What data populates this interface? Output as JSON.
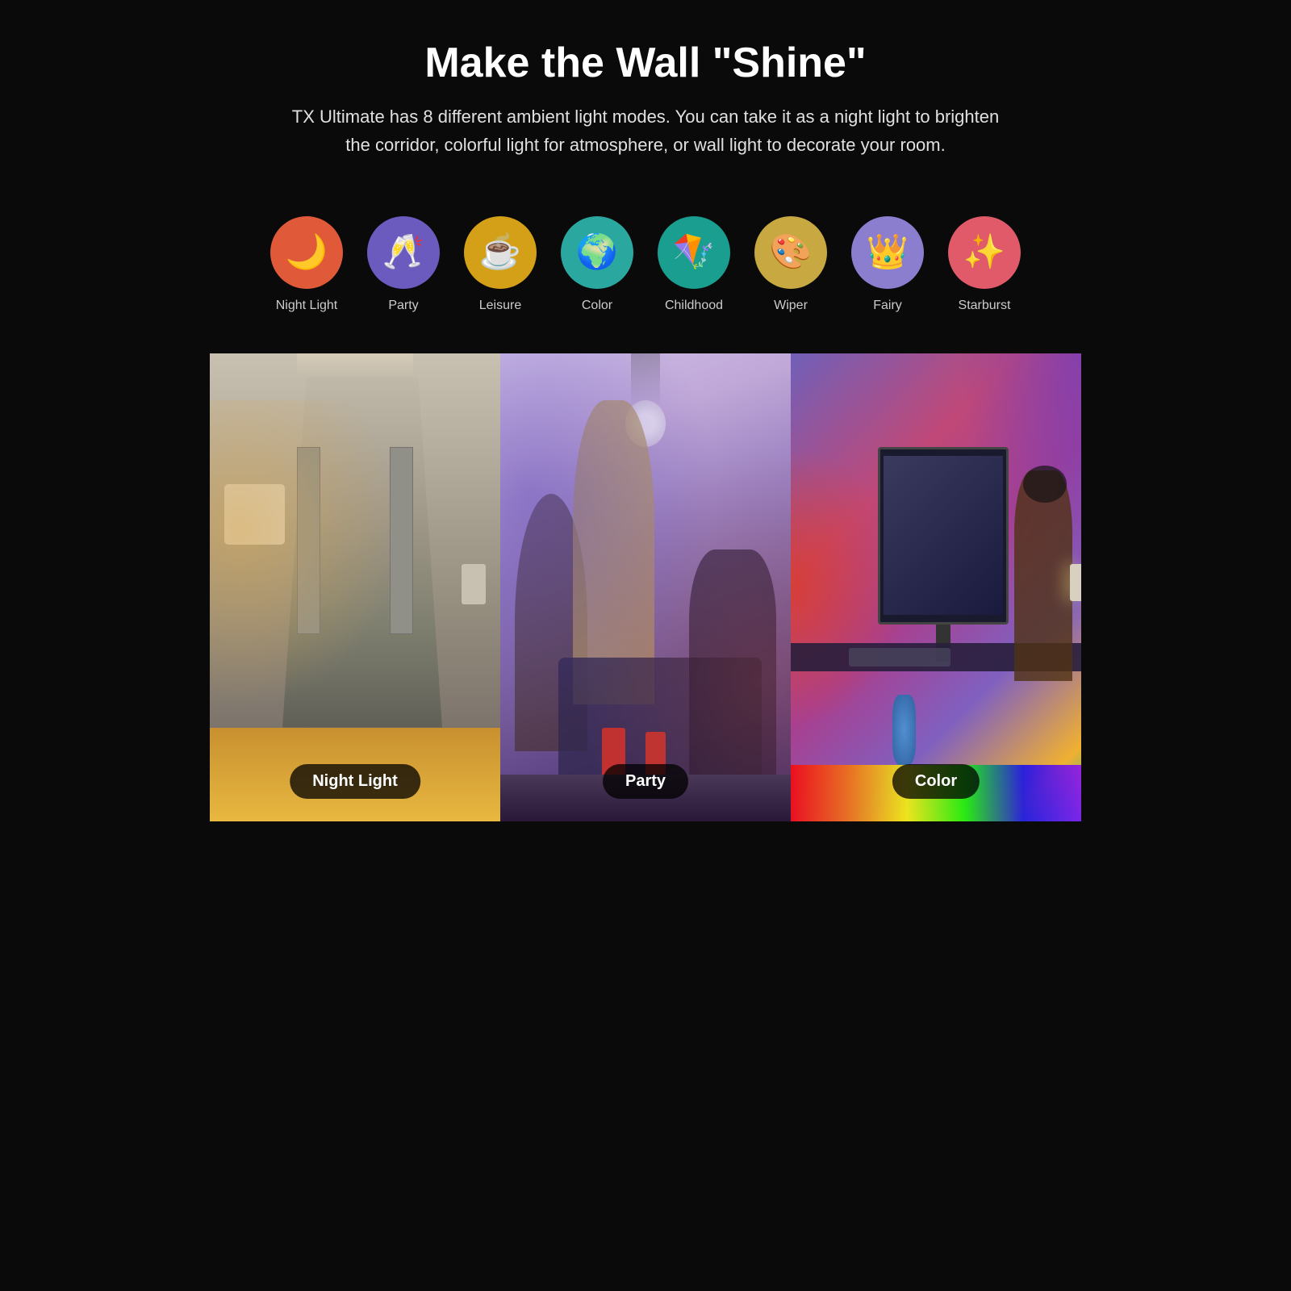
{
  "header": {
    "title": "Make the Wall \"Shine\"",
    "subtitle": "TX Ultimate has 8 different ambient light modes. You can take it as a night light to brighten the corridor, colorful light for atmosphere, or wall light to decorate your room."
  },
  "modes": [
    {
      "id": "night-light",
      "label": "Night Light",
      "icon": "🌙",
      "icon_class": "icon-night-light",
      "emoji": "🌙"
    },
    {
      "id": "party",
      "label": "Party",
      "icon": "🥂",
      "icon_class": "icon-party",
      "emoji": "🥂"
    },
    {
      "id": "leisure",
      "label": "Leisure",
      "icon": "☕",
      "icon_class": "icon-leisure",
      "emoji": "☕"
    },
    {
      "id": "color",
      "label": "Color",
      "icon": "🌍",
      "icon_class": "icon-color",
      "emoji": "🌍"
    },
    {
      "id": "childhood",
      "label": "Childhood",
      "icon": "🪁",
      "icon_class": "icon-childhood",
      "emoji": "🪁"
    },
    {
      "id": "wiper",
      "label": "Wiper",
      "icon": "🎨",
      "icon_class": "icon-wiper",
      "emoji": "🎨"
    },
    {
      "id": "fairy",
      "label": "Fairy",
      "icon": "👑",
      "icon_class": "icon-fairy",
      "emoji": "👑"
    },
    {
      "id": "starburst",
      "label": "Starburst",
      "icon": "✨",
      "icon_class": "icon-starburst",
      "emoji": "✨"
    }
  ],
  "photos": [
    {
      "id": "night-light-photo",
      "label": "Night Light",
      "scene": "night-light"
    },
    {
      "id": "party-photo",
      "label": "Party",
      "scene": "party"
    },
    {
      "id": "color-photo",
      "label": "Color",
      "scene": "color"
    }
  ]
}
